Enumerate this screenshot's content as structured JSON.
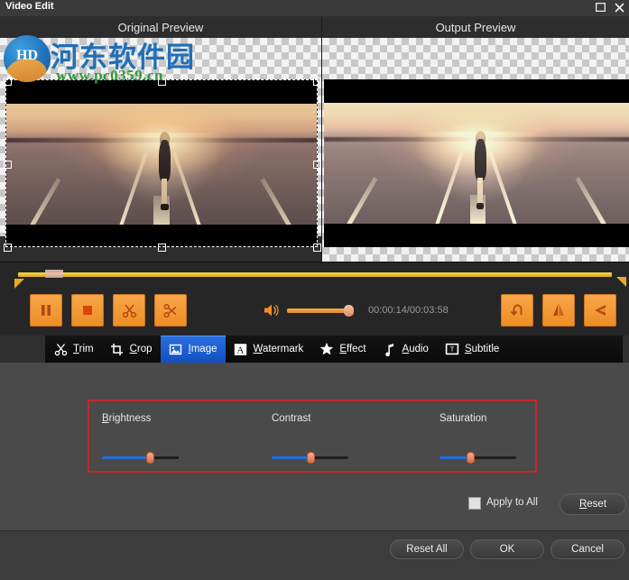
{
  "window": {
    "title": "Video Edit",
    "maximize_icon": "maximize-icon",
    "close_icon": "close-icon"
  },
  "preview": {
    "original_label": "Original Preview",
    "output_label": "Output Preview"
  },
  "watermark": {
    "logo_text": "HD",
    "chinese_text": "河东软件园",
    "url": "www.pc0359.cn"
  },
  "timeline": {
    "playhead_percent": 6,
    "track_color": "#f0cc35",
    "marker_color": "#e8a92a"
  },
  "controls": {
    "buttons": [
      {
        "name": "pause-button",
        "icon": "pause-icon"
      },
      {
        "name": "stop-button",
        "icon": "stop-icon"
      },
      {
        "name": "cut-button",
        "icon": "scissors-icon"
      },
      {
        "name": "split-button",
        "icon": "scissors-cut-icon"
      }
    ],
    "right_buttons": [
      {
        "name": "rotate-button",
        "icon": "rotate-left-icon"
      },
      {
        "name": "flip-horizontal-button",
        "icon": "flip-horizontal-icon"
      },
      {
        "name": "flip-vertical-button",
        "icon": "flip-vertical-icon"
      }
    ],
    "volume_icon": "speaker-icon",
    "volume_percent": 88,
    "time_label": "00:00:14/00:03:58"
  },
  "tabs": [
    {
      "label": "Trim",
      "accel": "T",
      "icon": "scissors-icon",
      "active": false
    },
    {
      "label": "Crop",
      "accel": "C",
      "icon": "crop-icon",
      "active": false
    },
    {
      "label": "Image",
      "accel": "I",
      "icon": "image-icon",
      "active": true
    },
    {
      "label": "Watermark",
      "accel": "W",
      "icon": "text-a-icon",
      "active": false
    },
    {
      "label": "Effect",
      "accel": "E",
      "icon": "star-icon",
      "active": false
    },
    {
      "label": "Audio",
      "accel": "A",
      "icon": "music-note-icon",
      "active": false
    },
    {
      "label": "Subtitle",
      "accel": "S",
      "icon": "subtitle-icon",
      "active": false
    }
  ],
  "image_panel": {
    "highlight_color": "#c0282d",
    "sliders": [
      {
        "label": "Brightness",
        "accel": "B",
        "value_percent": 62
      },
      {
        "label": "Contrast",
        "accel": "",
        "value_percent": 50
      },
      {
        "label": "Saturation",
        "accel": "",
        "value_percent": 40
      }
    ],
    "apply_to_all_label": "Apply to All",
    "apply_to_all_checked": false,
    "reset_label": "Reset",
    "reset_accel": "R"
  },
  "footer": {
    "reset_all_label": "Reset All",
    "ok_label": "OK",
    "cancel_label": "Cancel"
  }
}
